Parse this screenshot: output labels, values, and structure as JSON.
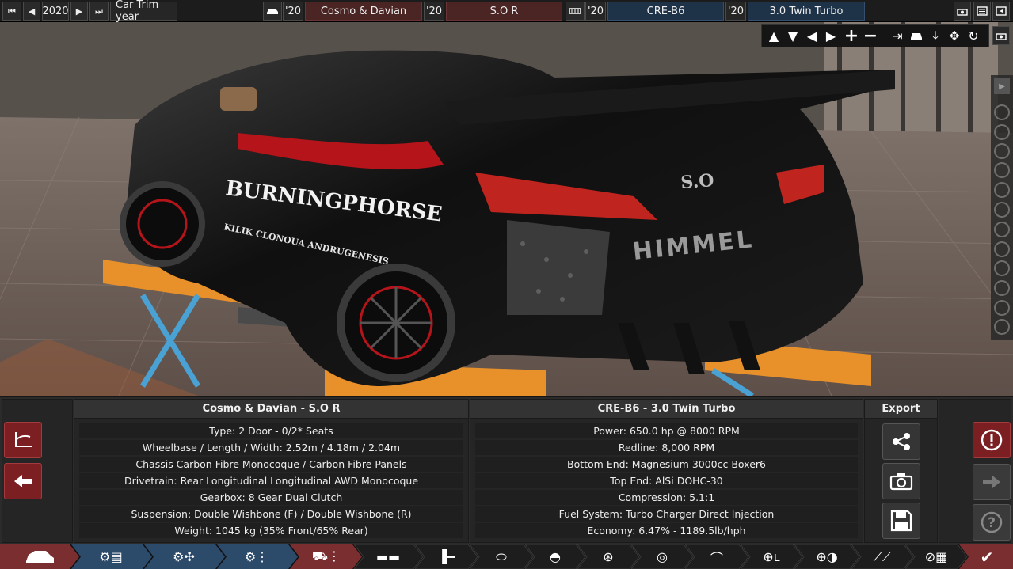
{
  "topbar": {
    "year": "2020",
    "year_label": "Car Trim year",
    "model_year": "'20",
    "model_name": "Cosmo & Davian",
    "trim_year": "'20",
    "trim_name": "S.O R",
    "engine_year": "'20",
    "engine_name": "CRE-B6",
    "variant_year": "'20",
    "variant_name": "3.0 Twin Turbo"
  },
  "car_panel": {
    "title": "Cosmo & Davian - S.O R",
    "rows": [
      "Type: 2 Door - 0/2* Seats",
      "Wheelbase / Length / Width: 2.52m / 4.18m / 2.04m",
      "Chassis Carbon Fibre Monocoque / Carbon Fibre Panels",
      "Drivetrain: Rear Longitudinal Longitudinal AWD Monocoque",
      "Gearbox: 8 Gear Dual Clutch",
      "Suspension: Double Wishbone (F) / Double Wishbone (R)",
      "Weight: 1045 kg (35% Front/65% Rear)"
    ]
  },
  "engine_panel": {
    "title": "CRE-B6 - 3.0 Twin Turbo",
    "rows": [
      "Power: 650.0 hp @ 8000 RPM",
      "Redline:  8,000 RPM",
      "Bottom End: Magnesium 3000cc Boxer6",
      "Top End: AlSi DOHC-30",
      "Compression: 5.1:1",
      "Fuel System: Turbo Charger Direct Injection",
      "Economy: 6.47% - 1189.5lb/hph"
    ]
  },
  "export_panel": {
    "title": "Export"
  },
  "car_livery": {
    "side_text": "BURNINGPHORSE",
    "side_subtext": "KILIK  CLONOUA  ANDRUGENESIS",
    "rear_badge": "S.O",
    "rear_brand": "HIMMEL"
  },
  "colors": {
    "maroon": "#4b2424",
    "navy": "#1e3248",
    "nav_active": "#7b2e30",
    "nav_blue": "#2c4a6a",
    "alert_red": "#7b1f23"
  }
}
